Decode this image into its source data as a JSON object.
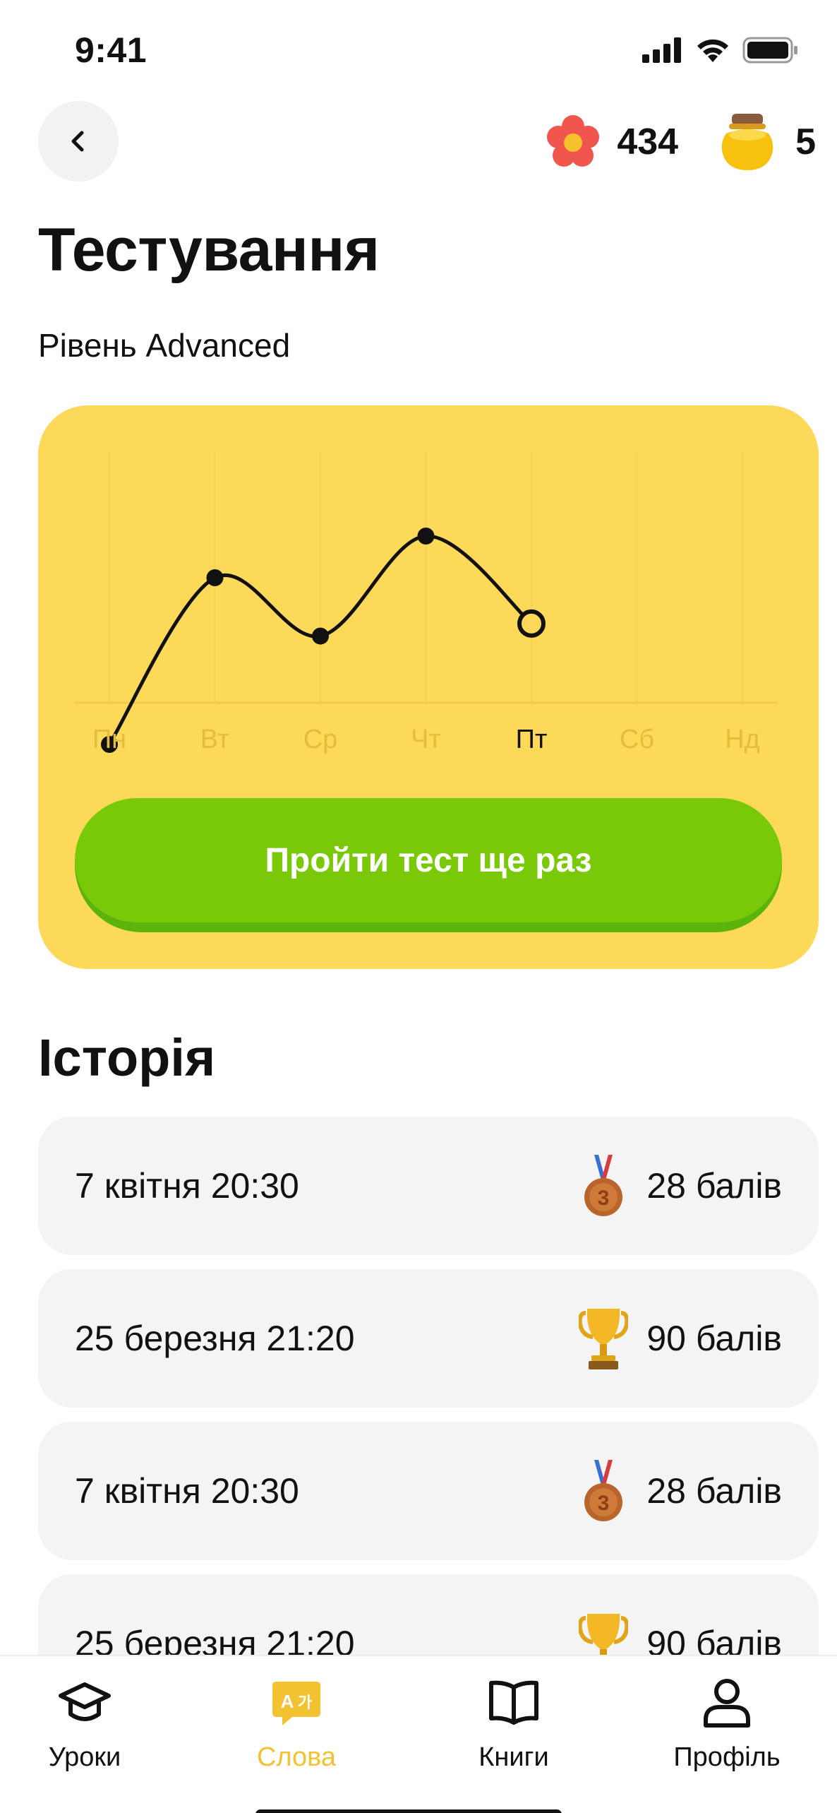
{
  "status_bar": {
    "time": "9:41"
  },
  "header": {
    "flowers_count": "434",
    "honey_count": "5"
  },
  "page": {
    "title": "Тестування",
    "subtitle": "Рівень Advanced"
  },
  "chart_data": {
    "type": "line",
    "categories": [
      "Пн",
      "Вт",
      "Ср",
      "Чт",
      "Пт",
      "Сб",
      "Нд"
    ],
    "values": [
      2,
      6,
      4.6,
      7,
      4.9,
      null,
      null
    ],
    "current_index": 4,
    "grid": true
  },
  "chart_style": {
    "line_color": "#111111",
    "grid_color": "#f2c94c",
    "card_color": "#fdd95a"
  },
  "retry_button": {
    "label": "Пройти тест ще раз"
  },
  "history": {
    "title": "Історія",
    "items": [
      {
        "date": "7 квітня 20:30",
        "score": "28 балів",
        "badge": "bronze-medal"
      },
      {
        "date": "25 березня 21:20",
        "score": "90 балів",
        "badge": "gold-trophy"
      },
      {
        "date": "7 квітня 20:30",
        "score": "28 балів",
        "badge": "bronze-medal"
      },
      {
        "date": "25 березня 21:20",
        "score": "90 балів",
        "badge": "gold-trophy"
      }
    ]
  },
  "nav": {
    "items": [
      {
        "label": "Уроки",
        "icon": "graduation-cap-icon",
        "active": false
      },
      {
        "label": "Слова",
        "icon": "translate-chat-icon",
        "active": true
      },
      {
        "label": "Книги",
        "icon": "open-book-icon",
        "active": false
      },
      {
        "label": "Профіль",
        "icon": "user-icon",
        "active": false
      }
    ],
    "active_color": "#f2c230"
  }
}
